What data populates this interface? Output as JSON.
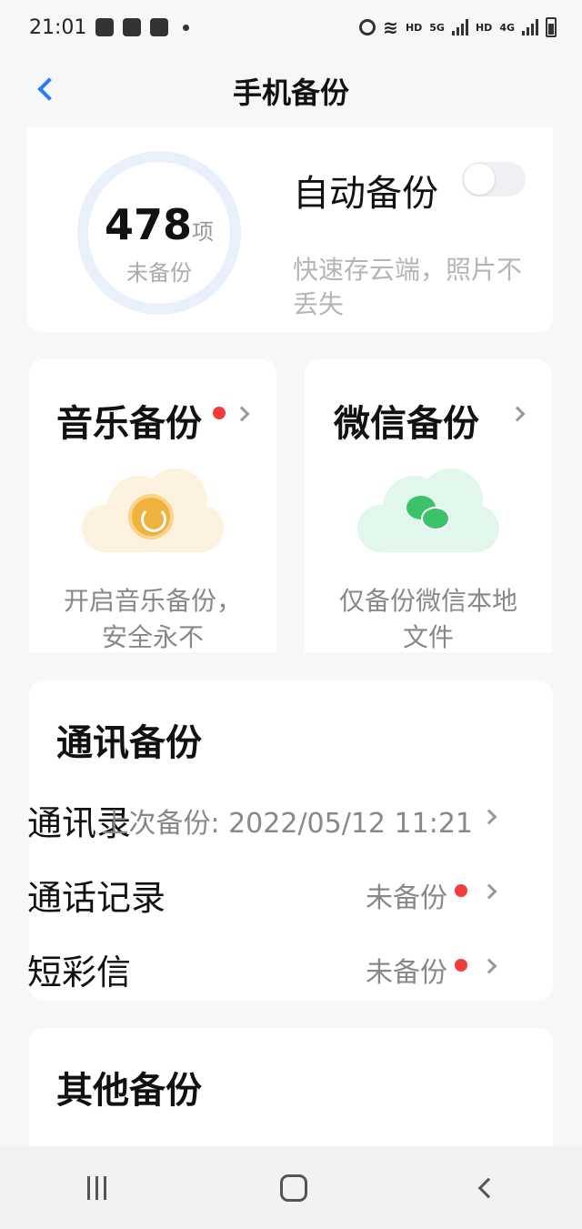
{
  "status_bar": {
    "time": "21:01",
    "network_labels": [
      "HD",
      "5G",
      "HD",
      "4G"
    ]
  },
  "header": {
    "title": "手机备份"
  },
  "backup_summary": {
    "count": "478",
    "count_unit": "项",
    "count_label": "未备份",
    "auto_backup_title": "自动备份",
    "auto_backup_enabled": false,
    "auto_backup_desc": "快速存云端，照片不丢失"
  },
  "music_card": {
    "title": "音乐备份",
    "desc": "开启音乐备份，安全永不"
  },
  "wechat_card": {
    "title": "微信备份",
    "desc": "仅备份微信本地文件"
  },
  "comm_section": {
    "title": "通讯备份",
    "rows": [
      {
        "label": "通讯录",
        "value": "上次备份: 2022/05/12 11:21"
      },
      {
        "label": "通话记录",
        "value": "未备份"
      },
      {
        "label": "短彩信",
        "value": "未备份"
      }
    ]
  },
  "other_section": {
    "title": "其他备份"
  },
  "colors": {
    "accent": "#2a7cf6",
    "alert_dot": "#f23b3b",
    "music": "#f0b23c",
    "wechat": "#3cc36a"
  }
}
